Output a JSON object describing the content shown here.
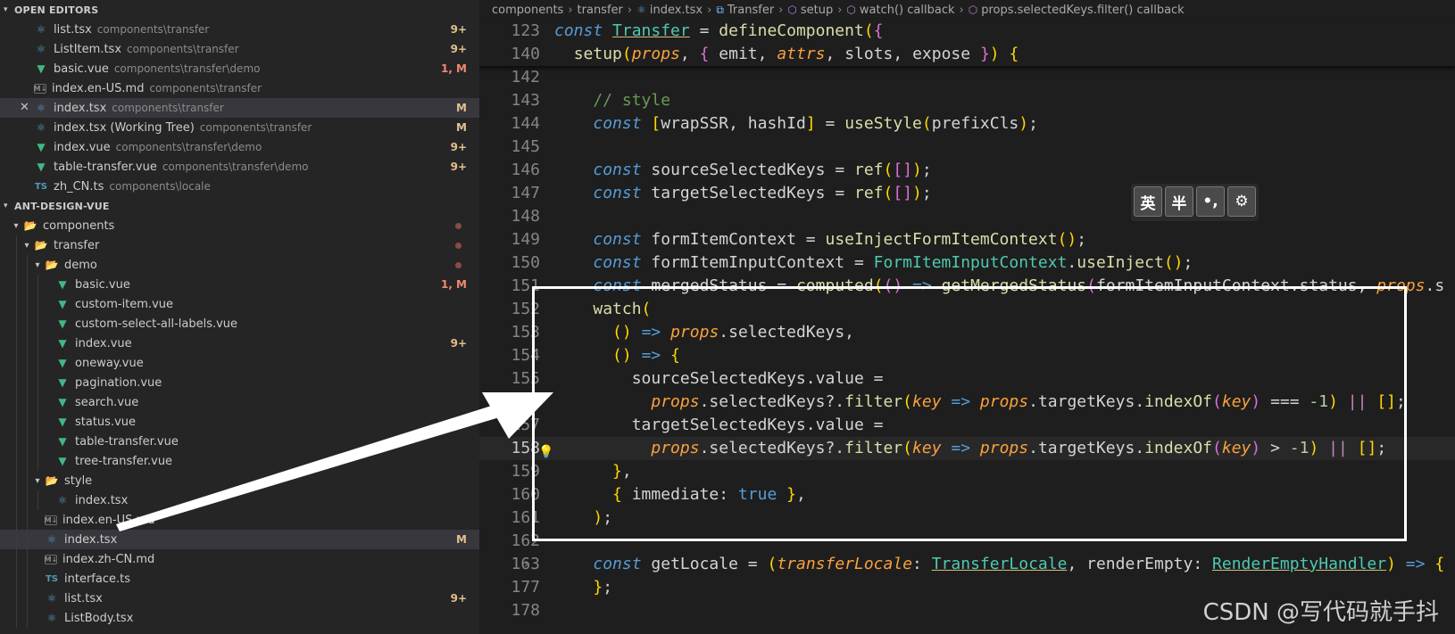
{
  "sidebar": {
    "open_editors": {
      "header": "OPEN EDITORS",
      "items": [
        {
          "name": "list.tsx",
          "path": "components\\transfer",
          "badge": "9+",
          "icon": "react-icon",
          "state": "mod"
        },
        {
          "name": "ListItem.tsx",
          "path": "components\\transfer",
          "badge": "9+",
          "icon": "react-icon",
          "state": "mod"
        },
        {
          "name": "basic.vue",
          "path": "components\\transfer\\demo",
          "badge": "1, M",
          "icon": "vue-icon",
          "state": "err"
        },
        {
          "name": "index.en-US.md",
          "path": "components\\transfer",
          "badge": "",
          "icon": "markdown-icon",
          "state": "def"
        },
        {
          "name": "index.tsx",
          "path": "components\\transfer",
          "badge": "M",
          "icon": "react-icon",
          "state": "mod"
        },
        {
          "name": "index.tsx (Working Tree)",
          "path": "components\\transfer",
          "badge": "M",
          "icon": "react-icon",
          "state": "mod"
        },
        {
          "name": "index.vue",
          "path": "components\\transfer\\demo",
          "badge": "9+",
          "icon": "vue-icon",
          "state": "mod"
        },
        {
          "name": "table-transfer.vue",
          "path": "components\\transfer\\demo",
          "badge": "9+",
          "icon": "vue-icon",
          "state": "mod"
        },
        {
          "name": "zh_CN.ts",
          "path": "components\\locale",
          "badge": "",
          "icon": "ts-icon",
          "state": "def"
        }
      ]
    },
    "workspace": {
      "header": "ANT-DESIGN-VUE",
      "tree": [
        {
          "name": "components",
          "badge": "",
          "icon": "folder-icon",
          "state": "err",
          "level": 1
        },
        {
          "name": "transfer",
          "badge": "",
          "icon": "folder-icon",
          "state": "err",
          "level": 2
        },
        {
          "name": "demo",
          "badge": "",
          "icon": "folder-icon",
          "state": "err",
          "level": 3
        },
        {
          "name": "basic.vue",
          "badge": "1, M",
          "icon": "vue-icon",
          "state": "err",
          "level": 4
        },
        {
          "name": "custom-item.vue",
          "badge": "",
          "icon": "vue-icon",
          "state": "def",
          "level": 4
        },
        {
          "name": "custom-select-all-labels.vue",
          "badge": "",
          "icon": "vue-icon",
          "state": "def",
          "level": 4
        },
        {
          "name": "index.vue",
          "badge": "9+",
          "icon": "vue-icon",
          "state": "mod",
          "level": 4
        },
        {
          "name": "oneway.vue",
          "badge": "",
          "icon": "vue-icon",
          "state": "def",
          "level": 4
        },
        {
          "name": "pagination.vue",
          "badge": "",
          "icon": "vue-icon",
          "state": "def",
          "level": 4
        },
        {
          "name": "search.vue",
          "badge": "",
          "icon": "vue-icon",
          "state": "def",
          "level": 4
        },
        {
          "name": "status.vue",
          "badge": "",
          "icon": "vue-icon",
          "state": "def",
          "level": 4
        },
        {
          "name": "table-transfer.vue",
          "badge": "",
          "icon": "vue-icon",
          "state": "mod",
          "level": 4
        },
        {
          "name": "tree-transfer.vue",
          "badge": "",
          "icon": "vue-icon",
          "state": "def",
          "level": 4
        },
        {
          "name": "style",
          "badge": "",
          "icon": "folder-icon",
          "state": "def",
          "level": 3
        },
        {
          "name": "index.tsx",
          "badge": "",
          "icon": "react-icon",
          "state": "def",
          "level": 4
        },
        {
          "name": "index.en-US.md",
          "badge": "",
          "icon": "markdown-icon",
          "state": "def",
          "level": 3
        },
        {
          "name": "index.tsx",
          "badge": "M",
          "icon": "react-icon",
          "state": "mod",
          "level": 3
        },
        {
          "name": "index.zh-CN.md",
          "badge": "",
          "icon": "markdown-icon",
          "state": "def",
          "level": 3
        },
        {
          "name": "interface.ts",
          "badge": "",
          "icon": "ts-icon",
          "state": "def",
          "level": 3
        },
        {
          "name": "list.tsx",
          "badge": "9+",
          "icon": "react-icon",
          "state": "mod",
          "level": 3
        },
        {
          "name": "ListBody.tsx",
          "badge": "",
          "icon": "react-icon",
          "state": "def",
          "level": 3
        }
      ]
    }
  },
  "breadcrumb": [
    "components",
    "transfer",
    "index.tsx",
    "Transfer",
    "setup",
    "watch() callback",
    "props.selectedKeys.filter() callback"
  ],
  "editor": {
    "sticky_lines": [
      {
        "num": "123",
        "text": "const Transfer = defineComponent({"
      },
      {
        "num": "140",
        "text": "  setup(props, { emit, attrs, slots, expose }) {"
      }
    ],
    "lines": [
      {
        "num": "142",
        "text": ""
      },
      {
        "num": "143",
        "text": "    // style"
      },
      {
        "num": "144",
        "text": "    const [wrapSSR, hashId] = useStyle(prefixCls);"
      },
      {
        "num": "145",
        "text": ""
      },
      {
        "num": "146",
        "text": "    const sourceSelectedKeys = ref([]);"
      },
      {
        "num": "147",
        "text": "    const targetSelectedKeys = ref([]);"
      },
      {
        "num": "148",
        "text": ""
      },
      {
        "num": "149",
        "text": "    const formItemContext = useInjectFormItemContext();"
      },
      {
        "num": "150",
        "text": "    const formItemInputContext = FormItemInputContext.useInject();"
      },
      {
        "num": "151",
        "text": "    const mergedStatus = computed(() => getMergedStatus(formItemInputContext.status, props.s"
      },
      {
        "num": "152",
        "text": "    watch("
      },
      {
        "num": "153",
        "text": "      () => props.selectedKeys,"
      },
      {
        "num": "154",
        "text": "      () => {"
      },
      {
        "num": "155",
        "text": "        sourceSelectedKeys.value ="
      },
      {
        "num": "156",
        "text": "          props.selectedKeys?.filter(key => props.targetKeys.indexOf(key) === -1) || [];"
      },
      {
        "num": "157",
        "text": "        targetSelectedKeys.value ="
      },
      {
        "num": "158",
        "text": "          props.selectedKeys?.filter(key => props.targetKeys.indexOf(key) > -1) || [];"
      },
      {
        "num": "159",
        "text": "      },"
      },
      {
        "num": "160",
        "text": "      { immediate: true },"
      },
      {
        "num": "161",
        "text": "    );"
      },
      {
        "num": "162",
        "text": ""
      },
      {
        "num": "163",
        "text": "    const getLocale = (transferLocale: TransferLocale, renderEmpty: RenderEmptyHandler) => {"
      },
      {
        "num": "177",
        "text": "    };"
      },
      {
        "num": "178",
        "text": ""
      }
    ]
  },
  "ime_toolbar": [
    "英",
    "半",
    "•,",
    "⚙"
  ],
  "watermark": "CSDN @写代码就手抖",
  "colors": {
    "modified": "#e2c08d",
    "error": "#f48771",
    "highlight_box": "#ffffff",
    "arrow": "#ffffff"
  }
}
